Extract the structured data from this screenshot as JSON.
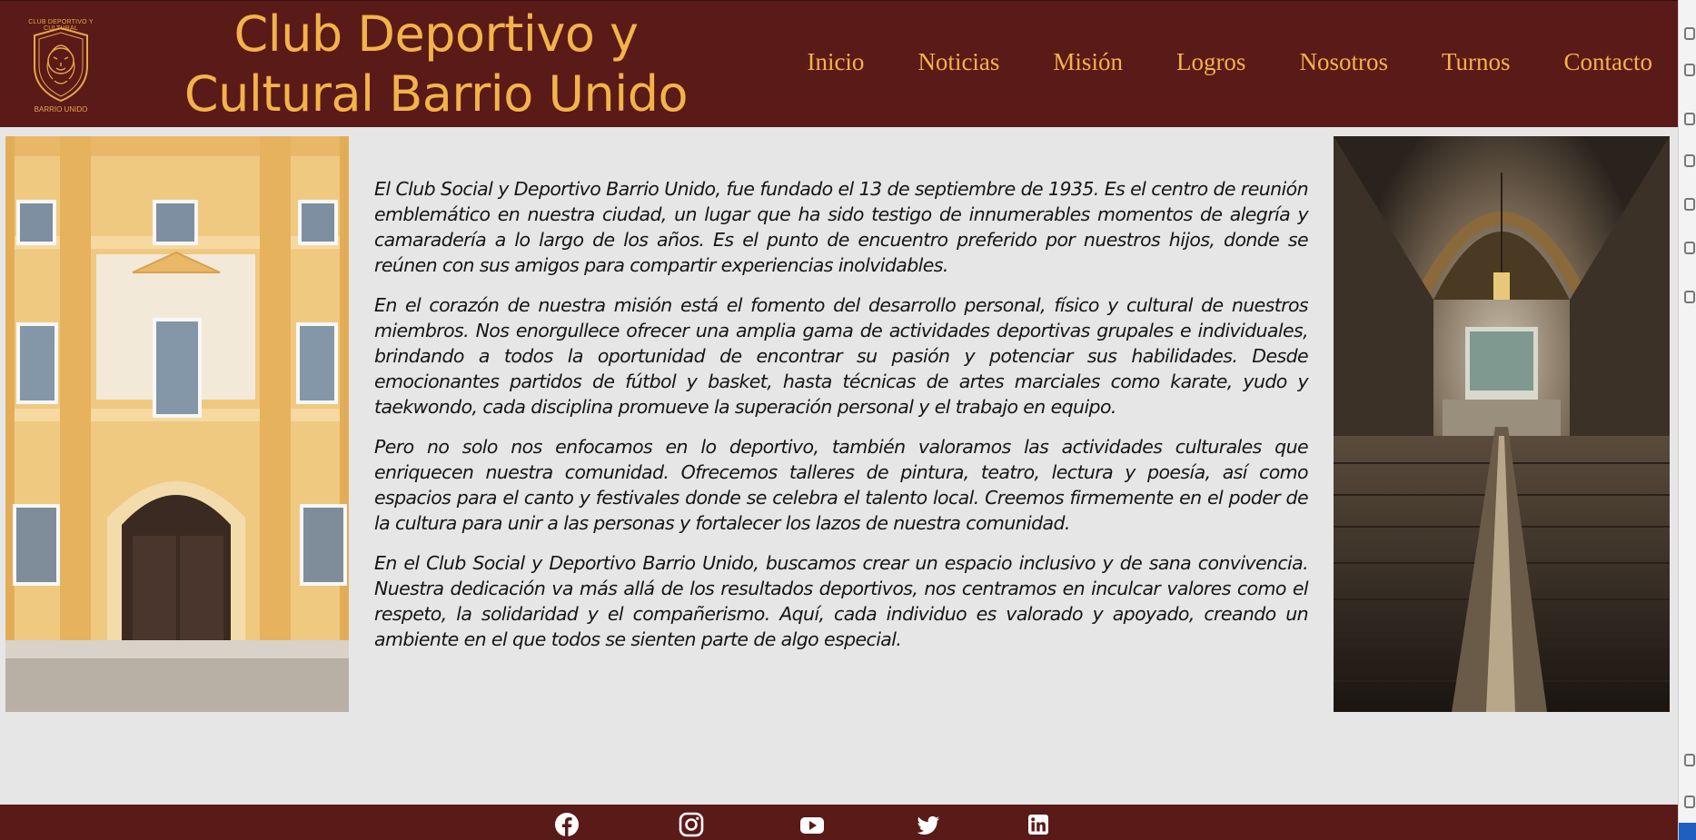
{
  "header": {
    "logo_text_top": "CLUB DEPORTIVO Y CULTURAL",
    "logo_text_bottom": "BARRIO UNIDO",
    "title_line1": "Club Deportivo y",
    "title_line2": "Cultural Barrio Unido"
  },
  "nav": {
    "items": [
      {
        "label": "Inicio"
      },
      {
        "label": "Noticias"
      },
      {
        "label": "Misión"
      },
      {
        "label": "Logros"
      },
      {
        "label": "Nosotros"
      },
      {
        "label": "Turnos"
      },
      {
        "label": "Contacto"
      }
    ]
  },
  "main": {
    "paragraphs": [
      "El Club Social y Deportivo Barrio Unido, fue fundado el 13 de septiembre de 1935. Es el centro de reunión emblemático en nuestra ciudad, un lugar que ha sido testigo de innumerables momentos de alegría y camaradería a lo largo de los años. Es el punto de encuentro preferido por nuestros hijos, donde se reúnen con sus amigos para compartir experiencias inolvidables.",
      "En el corazón de nuestra misión está el fomento del desarrollo personal, físico y cultural de nuestros miembros. Nos enorgullece ofrecer una amplia gama de actividades deportivas grupales e individuales, brindando a todos la oportunidad de encontrar su pasión y potenciar sus habilidades. Desde emocionantes partidos de fútbol y basket, hasta técnicas de artes marciales como karate, yudo y taekwondo, cada disciplina promueve la superación personal y el trabajo en equipo.",
      "Pero no solo nos enfocamos en lo deportivo, también valoramos las actividades culturales que enriquecen nuestra comunidad. Ofrecemos talleres de pintura, teatro, lectura y poesía, así como espacios para el canto y festivales donde se celebra el talento local. Creemos firmemente en el poder de la cultura para unir a las personas y fortalecer los lazos de nuestra comunidad.",
      "En el Club Social y Deportivo Barrio Unido, buscamos crear un espacio inclusivo y de sana convivencia. Nuestra dedicación va más allá de los resultados deportivos, nos centramos en inculcar valores como el respeto, la solidaridad y el compañerismo. Aquí, cada individuo es valorado y apoyado, creando un ambiente en el que todos se sienten parte de algo especial."
    ]
  },
  "footer": {
    "social_icons": [
      "facebook-icon",
      "instagram-icon",
      "youtube-icon",
      "twitter-icon",
      "linkedin-icon"
    ]
  },
  "colors": {
    "header_bg": "#5a1a18",
    "accent": "#f2b34a",
    "main_bg": "#e6e6e6"
  }
}
